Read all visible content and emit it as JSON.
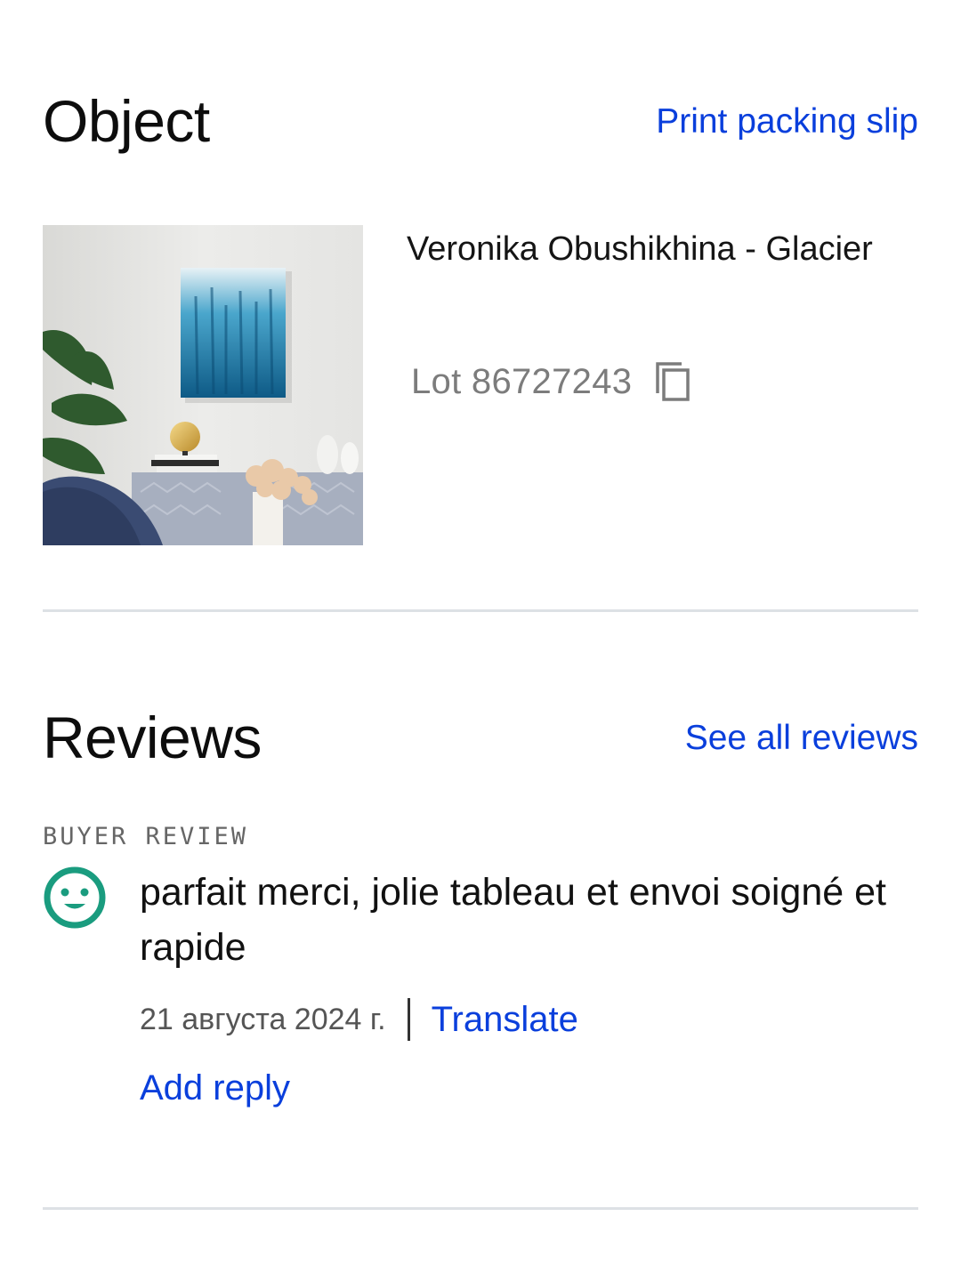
{
  "object_section": {
    "title": "Object",
    "print_link": "Print packing slip",
    "item": {
      "title": "Veronika Obushikhina - Glacier",
      "lot": "Lot 86727243",
      "image_icon": "artwork-photo",
      "copy_icon": "copy-icon"
    }
  },
  "reviews_section": {
    "title": "Reviews",
    "see_all_link": "See all reviews",
    "review": {
      "label": "BUYER REVIEW",
      "avatar_icon": "smiley-face-icon",
      "text": "parfait merci, jolie tableau et envoi soigné et rapide",
      "date": "21 августа 2024 г.",
      "translate_link": "Translate",
      "add_reply_link": "Add reply"
    }
  },
  "colors": {
    "link": "#0a3fdc",
    "avatar": "#1a9c7f",
    "divider": "#dde1e5",
    "muted_text": "#7c7c7c"
  }
}
